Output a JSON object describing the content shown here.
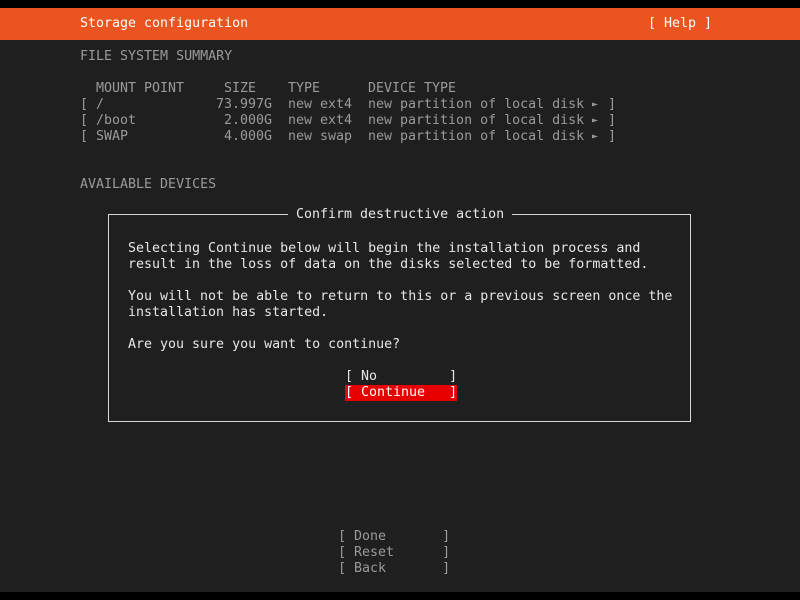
{
  "header": {
    "title": "Storage configuration",
    "help": "[ Help ]"
  },
  "fs_summary": {
    "heading": "FILE SYSTEM SUMMARY",
    "columns": {
      "mount": "MOUNT POINT",
      "size": "SIZE",
      "type": "TYPE",
      "device_type": "DEVICE TYPE"
    },
    "rows": [
      {
        "open": "[",
        "mount": "/",
        "size": "73.997G",
        "type": "new ext4",
        "device_type": "new partition of local disk",
        "arrow": "►",
        "close": "]"
      },
      {
        "open": "[",
        "mount": "/boot",
        "size": "2.000G",
        "type": "new ext4",
        "device_type": "new partition of local disk",
        "arrow": "►",
        "close": "]"
      },
      {
        "open": "[",
        "mount": "SWAP",
        "size": "4.000G",
        "type": "new swap",
        "device_type": "new partition of local disk",
        "arrow": "►",
        "close": "]"
      }
    ]
  },
  "available_devices": {
    "heading": "AVAILABLE DEVICES"
  },
  "dialog": {
    "title": "Confirm destructive action",
    "para1_line1": "Selecting Continue below will begin the installation process and",
    "para1_line2": "result in the loss of data on the disks selected to be formatted.",
    "para2_line1": "You will not be able to return to this or a previous screen once the",
    "para2_line2": "installation has started.",
    "question": "Are you sure you want to continue?",
    "btn_no": "[ No         ]",
    "btn_continue": "[ Continue   ]"
  },
  "bottom_buttons": {
    "done": "[ Done       ]",
    "reset": "[ Reset      ]",
    "back": "[ Back       ]"
  },
  "colors": {
    "header_bg": "#e95420",
    "selected_button_bg": "#e60000",
    "screen_bg": "#1f1f1f"
  }
}
